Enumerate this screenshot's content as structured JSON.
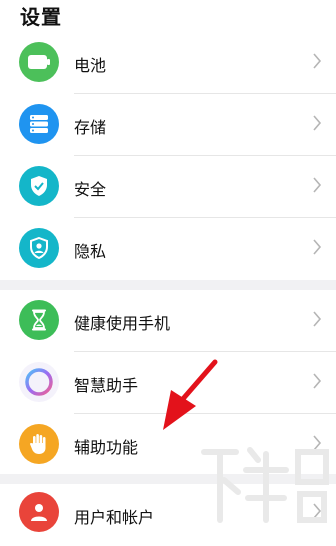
{
  "header": {
    "title": "设置"
  },
  "groups": [
    {
      "items": [
        {
          "label": "电池",
          "icon": "battery-icon",
          "color": "#4cc05a"
        },
        {
          "label": "存储",
          "icon": "storage-icon",
          "color": "#1f94f0"
        },
        {
          "label": "安全",
          "icon": "shield-icon",
          "color": "#14b6c9"
        },
        {
          "label": "隐私",
          "icon": "privacy-icon",
          "color": "#14b6c9"
        }
      ]
    },
    {
      "items": [
        {
          "label": "健康使用手机",
          "icon": "hourglass-icon",
          "color": "#3dbd58"
        },
        {
          "label": "智慧助手",
          "icon": "assistant-ring-icon",
          "color": "#9b6bf2"
        },
        {
          "label": "辅助功能",
          "icon": "hand-icon",
          "color": "#f5a623"
        }
      ]
    },
    {
      "items": [
        {
          "label": "用户和帐户",
          "icon": "user-icon",
          "color": "#e9443a"
        }
      ]
    }
  ],
  "annotation": {
    "arrow_color": "#e3121b"
  },
  "watermark": {
    "text": "下载吧"
  }
}
